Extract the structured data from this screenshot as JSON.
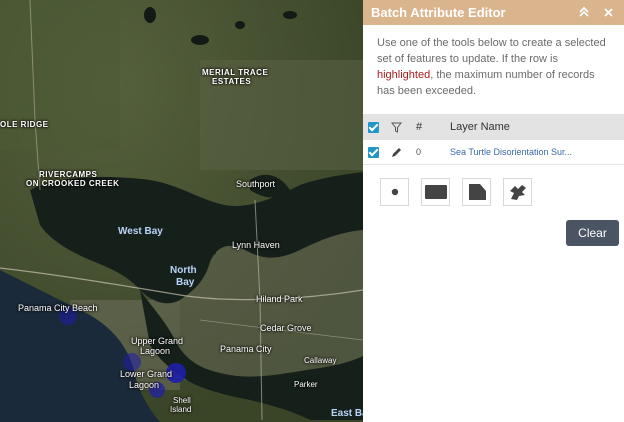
{
  "map": {
    "labels": {
      "merial_trace": "MERIAL TRACE",
      "estates": "ESTATES",
      "ole_ridge": "OLE RIDGE",
      "rivercamps": "RIVERCAMPS",
      "on_crooked_creek": "ON CROOKED CREEK",
      "southport": "Southport",
      "west_bay": "West Bay",
      "lynn_haven": "Lynn Haven",
      "north": "North",
      "bay": "Bay",
      "hiland_park": "Hiland Park",
      "panama_city_beach": "Panama City Beach",
      "cedar_grove": "Cedar Grove",
      "upper_grand": "Upper Grand",
      "lagoon": "Lagoon",
      "panama_city": "Panama City",
      "callaway": "Callaway",
      "lower_grand": "Lower Grand",
      "lagoon2": "Lagoon",
      "parker": "Parker",
      "shell": "Shell",
      "island": "Island",
      "east_bay": "East Bay"
    },
    "marker_color": "#1e1ea8"
  },
  "panel": {
    "title": "Batch Attribute Editor",
    "header_bg": "#d9b48c",
    "collapse_icon": "double-chevron-up-icon",
    "close_icon": "close-icon",
    "instructions_before": "Use one of the tools below to create a selected set of features to update. If the row is ",
    "instructions_highlight": "highlighted",
    "instructions_after": ", the maximum number of records has been exceeded.",
    "grid": {
      "headers": {
        "count": "#",
        "layer_name": "Layer Name"
      },
      "rows": [
        {
          "count": "0",
          "layer_name": "Sea Turtle Disorientation Sur..."
        }
      ]
    },
    "tools": [
      "point-tool-icon",
      "rectangle-tool-icon",
      "polygon-tool-icon",
      "freehand-tool-icon"
    ],
    "clear_label": "Clear"
  }
}
